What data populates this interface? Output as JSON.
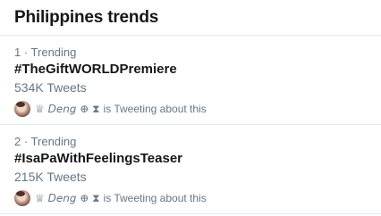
{
  "header": {
    "title": "Philippines trends"
  },
  "trends": [
    {
      "meta": "1 · Trending",
      "name": "#TheGiftWORLDPremiere",
      "count": "534K Tweets",
      "tweeter_name": "♕ 𝘋𝘦𝘯𝘨 ⊕ ⧗",
      "tweeter_suffix": "is Tweeting about this"
    },
    {
      "meta": "2 · Trending",
      "name": "#IsaPaWithFeelingsTeaser",
      "count": "215K Tweets",
      "tweeter_name": "♕ 𝘋𝘦𝘯𝘨 ⊕ ⧗",
      "tweeter_suffix": "is Tweeting about this"
    }
  ]
}
